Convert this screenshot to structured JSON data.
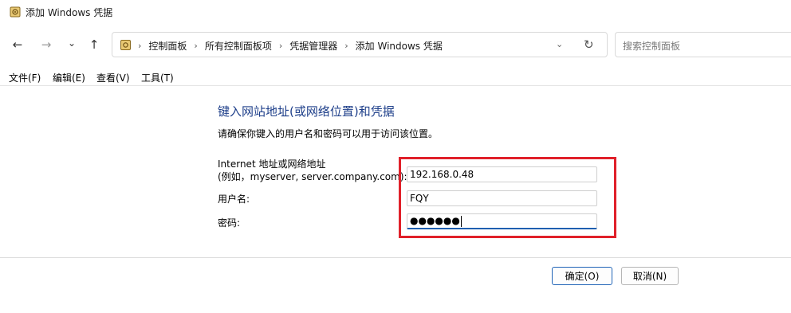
{
  "window": {
    "title": "添加 Windows 凭据",
    "icon": "credential-manager-icon"
  },
  "nav": {
    "back_icon": "←",
    "forward_icon": "→",
    "recent_icon": "⌄",
    "up_icon": "↑",
    "breadcrumbs": [
      "控制面板",
      "所有控制面板项",
      "凭据管理器",
      "添加 Windows 凭据"
    ],
    "dropdown_icon": "⌄",
    "refresh_icon": "↻",
    "search_placeholder": "搜索控制面板"
  },
  "menu": {
    "items": [
      "文件(F)",
      "编辑(E)",
      "查看(V)",
      "工具(T)"
    ]
  },
  "form": {
    "heading": "键入网站地址(或网络位置)和凭据",
    "description": "请确保你键入的用户名和密码可以用于访问该位置。",
    "address_label_line1": "Internet 地址或网络地址",
    "address_label_line2": "(例如，myserver, server.company.com):",
    "address_value": "192.168.0.48",
    "username_label": "用户名:",
    "username_value": "FQY",
    "password_label": "密码:",
    "password_value": "●●●●●●"
  },
  "buttons": {
    "ok": "确定(O)",
    "cancel": "取消(N)"
  },
  "colors": {
    "heading": "#1e3f8a",
    "highlight": "#e0202a",
    "focus": "#1f5fb0"
  }
}
